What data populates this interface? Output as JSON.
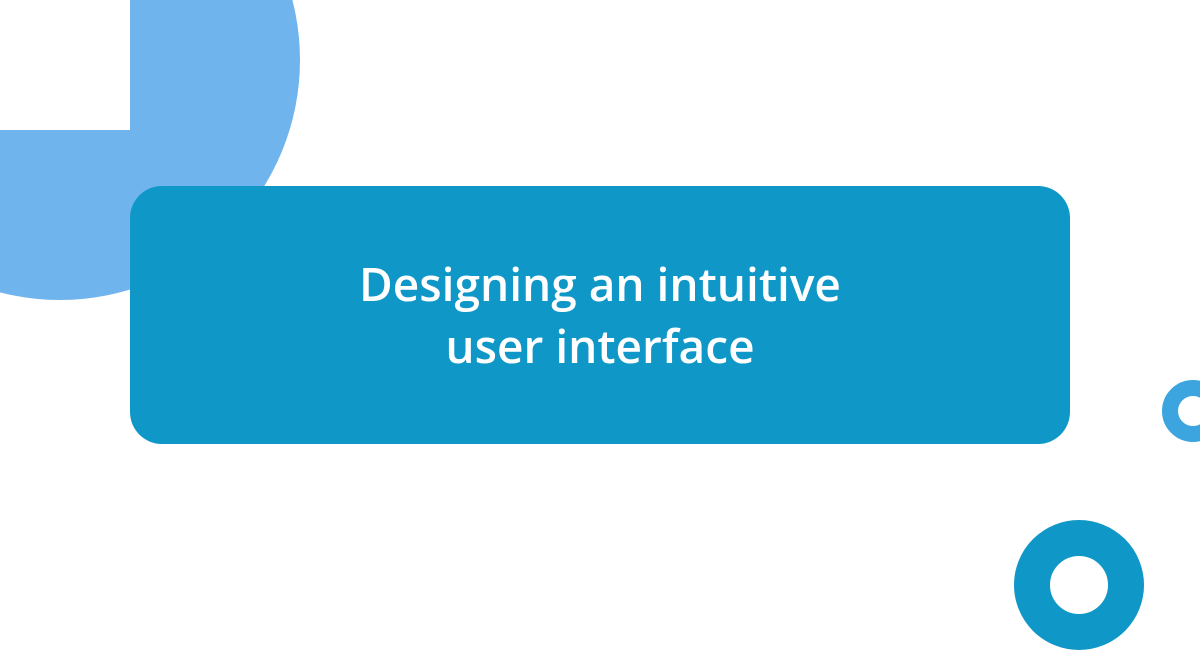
{
  "card": {
    "title_line1": "Designing an intuitive",
    "title_line2": "user interface"
  },
  "colors": {
    "card_bg": "#0f97c7",
    "corner_shape": "#6fb4ed",
    "ring_small": "#3ca5e0",
    "ring_large": "#0f97c7"
  }
}
